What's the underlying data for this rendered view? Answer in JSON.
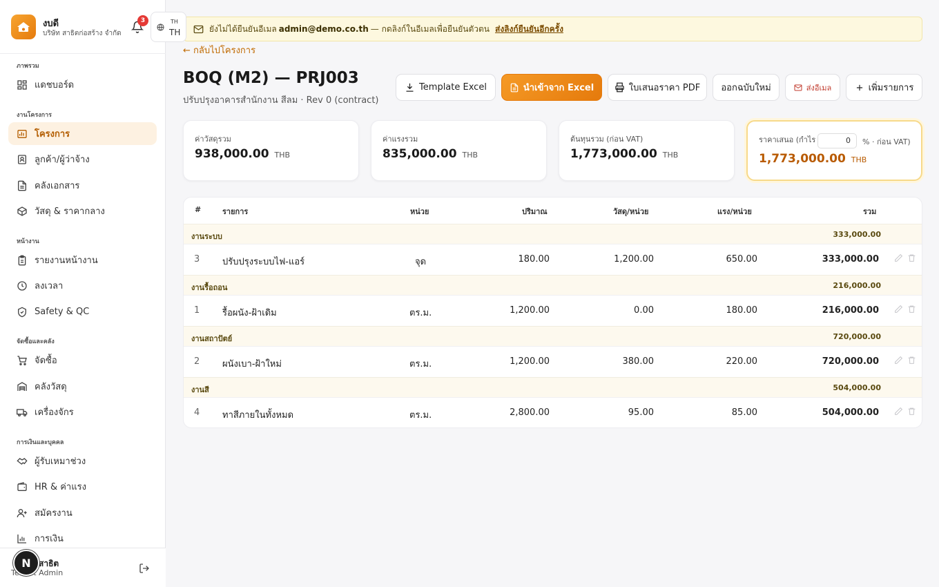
{
  "brand": {
    "name": "งบดี",
    "company": "บริษัท สาธิตก่อสร้าง จำกัด",
    "notif_count": "3"
  },
  "lang": {
    "small": "TH",
    "big": "TH"
  },
  "nav": {
    "sections": [
      "ภาพรวม",
      "งานโครงการ",
      "หน้างาน",
      "จัดซื้อและคลัง",
      "การเงินและบุคคล"
    ],
    "items": [
      {
        "label": "แดชบอร์ด",
        "icon": "dashboard-icon"
      },
      {
        "label": "โครงการ",
        "icon": "project-icon",
        "active": true
      },
      {
        "label": "ลูกค้า/ผู้ว่าจ้าง",
        "icon": "contact-icon"
      },
      {
        "label": "คลังเอกสาร",
        "icon": "document-icon"
      },
      {
        "label": "วัสดุ & ราคากลาง",
        "icon": "box-icon"
      },
      {
        "label": "รายงานหน้างาน",
        "icon": "clipboard-icon"
      },
      {
        "label": "ลงเวลา",
        "icon": "clock-icon"
      },
      {
        "label": "Safety & QC",
        "icon": "shield-icon"
      },
      {
        "label": "จัดซื้อ",
        "icon": "cart-icon"
      },
      {
        "label": "คลังวัสดุ",
        "icon": "warehouse-icon"
      },
      {
        "label": "เครื่องจักร",
        "icon": "truck-icon"
      },
      {
        "label": "ผู้รับเหมาช่วง",
        "icon": "handshake-icon"
      },
      {
        "label": "HR & ค่าแรง",
        "icon": "wallet-icon"
      },
      {
        "label": "สมัครงาน",
        "icon": "user-plus-icon"
      },
      {
        "label": "การเงิน",
        "icon": "chart-icon"
      }
    ]
  },
  "user": {
    "avatar": "N",
    "name": "สาธิต",
    "role": "Tenant Admin"
  },
  "banner": {
    "pre": "ยังไม่ได้ยืนยันอีเมล",
    "email": "admin@demo.co.th",
    "mid": "— กดลิงก์ในอีเมลเพื่อยืนยันตัวตน",
    "link": "ส่งลิงก์ยืนยันอีกครั้ง"
  },
  "page": {
    "back": "กลับไปโครงการ",
    "title": "BOQ (M2) — PRJ003",
    "subtitle": "ปรับปรุงอาคารสำนักงาน สีลม · Rev 0 (contract)"
  },
  "toolbar": {
    "template": "Template Excel",
    "import": "นำเข้าจาก Excel",
    "pdf": "ใบเสนอราคา PDF",
    "new_version": "ออกฉบับใหม่",
    "email": "ส่งอีเมล",
    "add": "เพิ่มรายการ"
  },
  "summary": {
    "material": {
      "label": "ค่าวัสดุรวม",
      "value": "938,000.00",
      "cur": "THB"
    },
    "labor": {
      "label": "ค่าแรงรวม",
      "value": "835,000.00",
      "cur": "THB"
    },
    "cost": {
      "label": "ต้นทุนรวม (ก่อน VAT)",
      "value": "1,773,000.00",
      "cur": "THB"
    },
    "quote": {
      "label": "ราคาเสนอ (กำไร",
      "margin": "0",
      "after": "% · ก่อน VAT)",
      "value": "1,773,000.00",
      "cur": "THB"
    }
  },
  "table": {
    "headers": {
      "idx": "#",
      "item": "รายการ",
      "unit": "หน่วย",
      "qty": "ปริมาณ",
      "mat": "วัสดุ/หน่วย",
      "lab": "แรง/หน่วย",
      "total": "รวม"
    },
    "groups": [
      {
        "name": "งานระบบ",
        "total": "333,000.00",
        "row": {
          "idx": "3",
          "item": "ปรับปรุงระบบไฟ-แอร์",
          "unit": "จุด",
          "qty": "180.00",
          "mat": "1,200.00",
          "lab": "650.00",
          "total": "333,000.00"
        }
      },
      {
        "name": "งานรื้อถอน",
        "total": "216,000.00",
        "row": {
          "idx": "1",
          "item": "รื้อผนัง-ฝ้าเดิม",
          "unit": "ตร.ม.",
          "qty": "1,200.00",
          "mat": "0.00",
          "lab": "180.00",
          "total": "216,000.00"
        }
      },
      {
        "name": "งานสถาปัตย์",
        "total": "720,000.00",
        "row": {
          "idx": "2",
          "item": "ผนังเบา-ฝ้าใหม่",
          "unit": "ตร.ม.",
          "qty": "1,200.00",
          "mat": "380.00",
          "lab": "220.00",
          "total": "720,000.00"
        }
      },
      {
        "name": "งานสี",
        "total": "504,000.00",
        "row": {
          "idx": "4",
          "item": "ทาสีภายในทั้งหมด",
          "unit": "ตร.ม.",
          "qty": "2,800.00",
          "mat": "95.00",
          "lab": "85.00",
          "total": "504,000.00"
        }
      }
    ]
  },
  "colors": {
    "accent": "#e57a0c",
    "accent_bg": "#fdf1e1",
    "banner_bg": "#fdf8df",
    "group_bg": "#fdf9ee",
    "badge": "#e53935"
  }
}
